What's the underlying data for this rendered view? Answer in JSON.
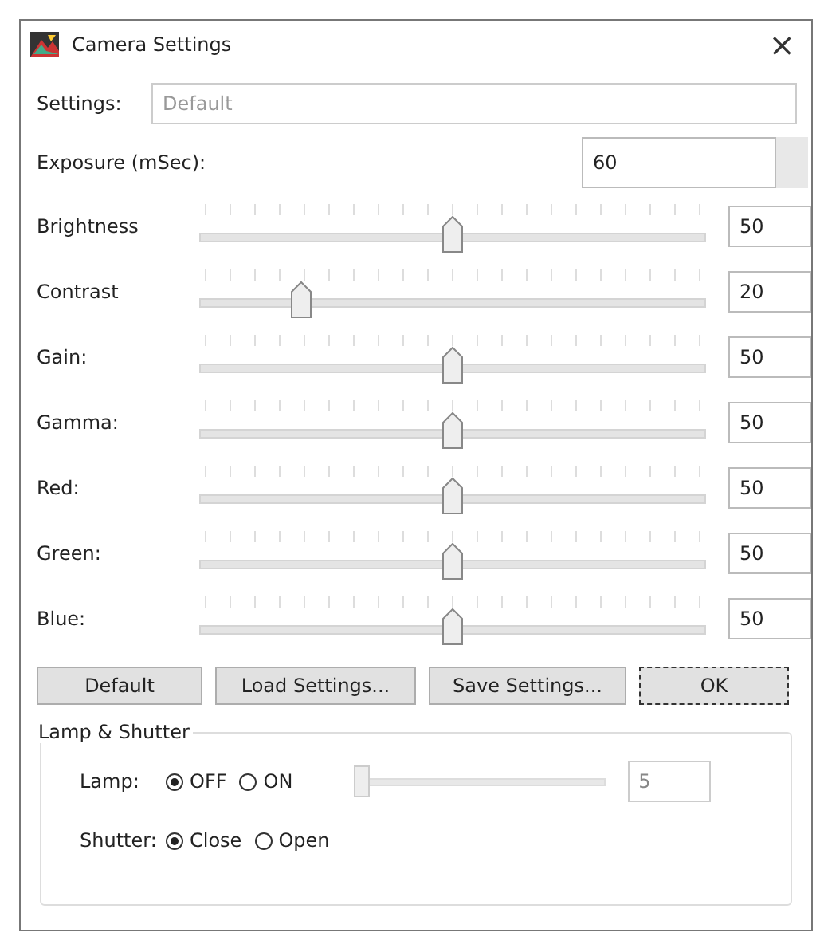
{
  "window": {
    "title": "Camera Settings",
    "close": "×"
  },
  "settings": {
    "label": "Settings:",
    "placeholder": "Default"
  },
  "exposure": {
    "label": "Exposure (mSec):",
    "value": "60"
  },
  "sliders": [
    {
      "label": "Brightness",
      "level": 0.5,
      "value": "50"
    },
    {
      "label": "Contrast",
      "level": 0.2,
      "value": "20"
    },
    {
      "label": "Gain:",
      "level": 0.5,
      "value": "50"
    },
    {
      "label": "Gamma:",
      "level": 0.5,
      "value": "50"
    },
    {
      "label": "Red:",
      "level": 0.5,
      "value": "50"
    },
    {
      "label": "Green:",
      "level": 0.5,
      "value": "50"
    },
    {
      "label": "Blue:",
      "level": 0.5,
      "value": "50"
    }
  ],
  "buttons": [
    {
      "label": "Default",
      "focused": false
    },
    {
      "label": "Load Settings...",
      "focused": false
    },
    {
      "label": "Save Settings...",
      "focused": false
    },
    {
      "label": "OK",
      "focused": true
    }
  ],
  "lamp_shutter": {
    "title": "Lamp & Shutter",
    "lamp": {
      "label": "Lamp:",
      "options": [
        {
          "label": "OFF",
          "selected": true
        },
        {
          "label": "ON",
          "selected": false
        }
      ],
      "level": 0,
      "value": "5"
    },
    "shutter": {
      "label": "Shutter:",
      "options": [
        {
          "label": "Close",
          "selected": true
        },
        {
          "label": "Open",
          "selected": false
        }
      ]
    }
  }
}
